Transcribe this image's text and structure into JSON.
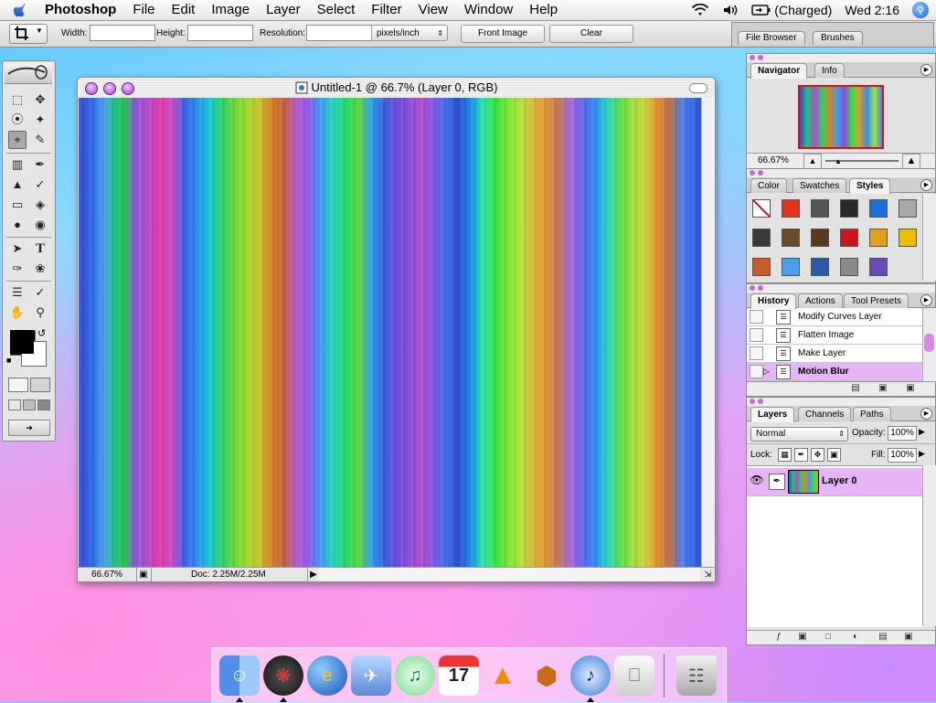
{
  "menubar": {
    "app_name": "Photoshop",
    "items": [
      "File",
      "Edit",
      "Image",
      "Layer",
      "Select",
      "Filter",
      "View",
      "Window",
      "Help"
    ],
    "battery": "(Charged)",
    "clock": "Wed 2:16",
    "icons": [
      "apple-icon",
      "wifi-icon",
      "volume-icon",
      "battery-icon",
      "spotlight-icon"
    ]
  },
  "options": {
    "width_label": "Width:",
    "height_label": "Height:",
    "width_value": "",
    "height_value": "",
    "resolution_label": "Resolution:",
    "resolution_value": "",
    "units": "pixels/inch",
    "front_image": "Front Image",
    "clear": "Clear"
  },
  "well": {
    "tabs": [
      "File Browser",
      "Brushes"
    ]
  },
  "document": {
    "title": "Untitled-1 @ 66.7% (Layer 0, RGB)",
    "zoom": "66.67%",
    "doc_info": "Doc: 2.25M/2.25M"
  },
  "navigator": {
    "tabs": [
      "Navigator",
      "Info"
    ],
    "zoom": "66.67%"
  },
  "styles_panel": {
    "tabs": [
      "Color",
      "Swatches",
      "Styles"
    ],
    "swatches": [
      "#ffffff",
      "#e0321c",
      "#555555",
      "#2a2a2a",
      "#1d6fd6",
      "#a8a8a8",
      "#3a3a3a",
      "#6b4a2a",
      "#5a3a1e",
      "#c8161a",
      "#e0a020",
      "#e8c000",
      "#c85a2a",
      "#4aa0e8",
      "#2a5aa8",
      "#8a8a8a",
      "#6a4ab8"
    ]
  },
  "history": {
    "tabs": [
      "History",
      "Actions",
      "Tool Presets"
    ],
    "items": [
      "Modify Curves Layer",
      "Flatten Image",
      "Make Layer",
      "Motion Blur"
    ]
  },
  "layers": {
    "tabs": [
      "Layers",
      "Channels",
      "Paths"
    ],
    "blend_mode": "Normal",
    "opacity_label": "Opacity:",
    "opacity": "100%",
    "lock_label": "Lock:",
    "fill_label": "Fill:",
    "fill": "100%",
    "layer_name": "Layer 0"
  },
  "dock": {
    "items": [
      "Finder",
      "Dashboard",
      "Internet Explorer",
      "Mail",
      "iTunes",
      "iCal",
      "VLC",
      "Reason",
      "iTunes Music",
      "Apple",
      "Trash"
    ]
  },
  "colors": {
    "selection": "#e5b5f5",
    "accent": "#c46ad8"
  }
}
